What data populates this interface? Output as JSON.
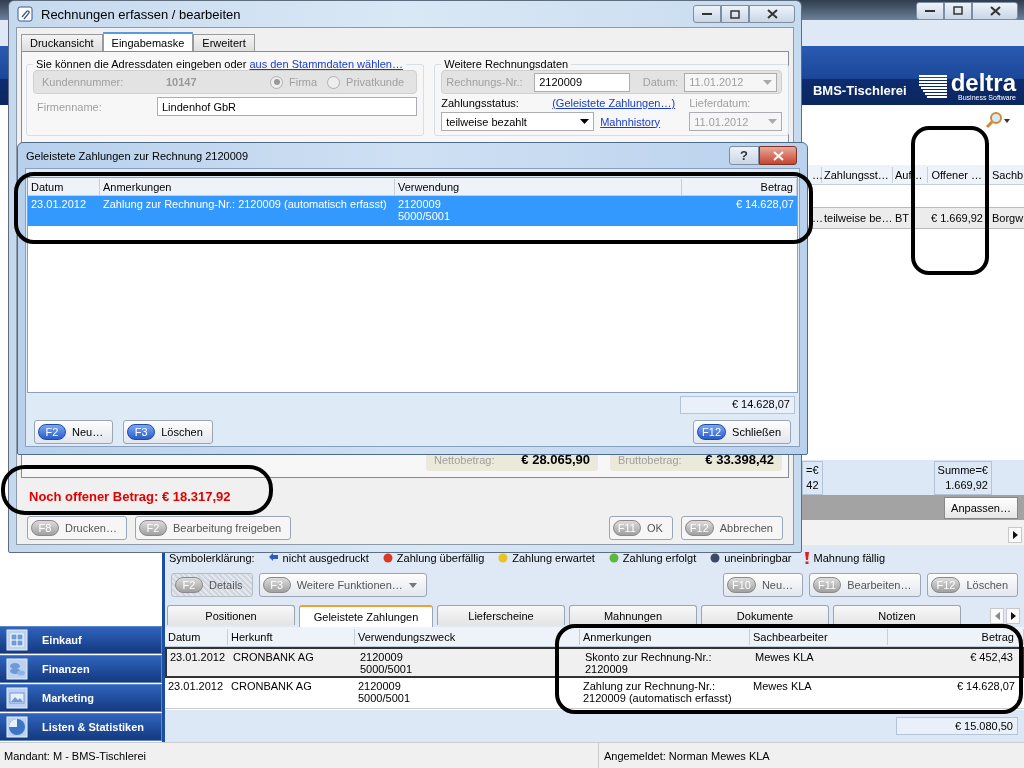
{
  "main_window": {
    "brand": {
      "company": "BMS-Tischlerei",
      "logo_name": "deltra",
      "logo_tagline": "Business Software"
    },
    "invoice_table": {
      "columns": [
        "…",
        "Zahlungsst…",
        "Auf…",
        "Offener …",
        "Sachb"
      ],
      "rows": [
        {
          "cells": [
            "…",
            "teilweise be…",
            "BT",
            "€ 1.669,92",
            "Borgw"
          ],
          "selected": true
        }
      ]
    },
    "totals": [
      {
        "label": "=€",
        "value": "42"
      },
      {
        "label": "Summe=€",
        "value": "1.669,92"
      }
    ],
    "customize_button": "Anpassen…",
    "legend": {
      "title": "Symbolerklärung:",
      "items": [
        {
          "label": "nicht ausgedruckt",
          "kind": "arrow",
          "color": "#2a5cc8"
        },
        {
          "label": "Zahlung überfällig",
          "kind": "dot",
          "color": "#d83a2a"
        },
        {
          "label": "Zahlung erwartet",
          "kind": "dot",
          "color": "#e8c420"
        },
        {
          "label": "Zahlung erfolgt",
          "kind": "dot",
          "color": "#5cb83a"
        },
        {
          "label": "uneinbringbar",
          "kind": "dot",
          "color": "#3a4a66"
        },
        {
          "label": "Mahnung fällig",
          "kind": "exclamation",
          "color": "#e02020"
        }
      ]
    },
    "toolbar_left": [
      {
        "key": "F2",
        "label": "Details",
        "kind": "toggle",
        "disabled": true
      },
      {
        "key": "F3",
        "label": "Weitere Funktionen…",
        "kind": "menu",
        "disabled": true
      }
    ],
    "toolbar_right": [
      {
        "key": "F10",
        "label": "Neu…",
        "disabled": true
      },
      {
        "key": "F11",
        "label": "Bearbeiten…",
        "disabled": true
      },
      {
        "key": "F12",
        "label": "Löschen",
        "disabled": true
      }
    ],
    "detail_tabs": [
      {
        "label": "Positionen",
        "selected": false
      },
      {
        "label": "Geleistete Zahlungen",
        "selected": true
      },
      {
        "label": "Lieferscheine",
        "selected": false
      },
      {
        "label": "Mahnungen",
        "selected": false
      },
      {
        "label": "Dokumente",
        "selected": false
      },
      {
        "label": "Notizen",
        "selected": false
      }
    ],
    "payments_table": {
      "columns": [
        "Datum",
        "Herkunft",
        "Verwendungszweck",
        "Anmerkungen",
        "Sachbearbeiter",
        "Betrag"
      ],
      "rows": [
        {
          "cells": [
            "23.01.2012",
            "CRONBANK AG",
            "2120009\n5000/5001",
            "Skonto zur Rechnung-Nr.:\n2120009",
            "Mewes  KLA",
            "€ 452,43"
          ],
          "selected": true
        },
        {
          "cells": [
            "23.01.2012",
            "CRONBANK AG",
            "2120009\n5000/5001",
            "Zahlung zur Rechnung-Nr.:\n2120009 (automatisch erfasst)",
            "Mewes  KLA",
            "€ 14.628,07"
          ],
          "selected": false
        }
      ],
      "total": "€ 15.080,50"
    },
    "sidebar": {
      "items": [
        {
          "label": "Einkauf"
        },
        {
          "label": "Finanzen"
        },
        {
          "label": "Marketing"
        },
        {
          "label": "Listen & Statistiken"
        }
      ]
    },
    "status_bar": {
      "left": "Mandant: M - BMS-Tischlerei",
      "right": "Angemeldet: Norman Mewes  KLA"
    }
  },
  "invoice_dialog": {
    "title": "Rechnungen erfassen / bearbeiten",
    "tabs": [
      {
        "label": "Druckansicht",
        "selected": false
      },
      {
        "label": "Eingabemaske",
        "selected": true
      },
      {
        "label": "Erweitert",
        "selected": false
      }
    ],
    "address_group": {
      "intro": "Sie können die Adressdaten eingeben oder",
      "link": "aus den Stammdaten wählen…",
      "customer_number_label": "Kundennummer:",
      "customer_number": "10147",
      "customer_types": [
        {
          "label": "Firma",
          "selected": true
        },
        {
          "label": "Privatkunde",
          "selected": false
        }
      ],
      "company_label": "Firmenname:",
      "company": "Lindenhof GbR"
    },
    "invoice_group": {
      "title": "Weitere Rechnungsdaten",
      "number_label": "Rechnungs-Nr.:",
      "number": "2120009",
      "date_label": "Datum:",
      "date": "11.01.2012",
      "status_label": "Zahlungsstatus:",
      "payments_link": "(Geleistete Zahlungen…)",
      "delivery_label": "Lieferdatum:",
      "status": "teilweise bezahlt",
      "dunning_link": "Mahnhistory",
      "delivery_date": "11.01.2012"
    },
    "totals": [
      {
        "label": "Nettobetrag:",
        "value": "€ 28.065,90"
      },
      {
        "label": "Bruttobetrag:",
        "value": "€ 33.398,42"
      }
    ],
    "open_amount": "Noch offener Betrag: € 18.317,92",
    "buttons_left": [
      {
        "key": "F8",
        "label": "Drucken…",
        "disabled": true
      },
      {
        "key": "F2",
        "label": "Bearbeitung freigeben",
        "disabled": true
      }
    ],
    "buttons_right": [
      {
        "key": "F11",
        "label": "OK",
        "disabled": true
      },
      {
        "key": "F12",
        "label": "Abbrechen",
        "disabled": true
      }
    ]
  },
  "payments_dialog": {
    "title": "Geleistete Zahlungen zur Rechnung 2120009",
    "help": "?",
    "columns": [
      "Datum",
      "Anmerkungen",
      "Verwendung",
      "Betrag"
    ],
    "rows": [
      {
        "cells": [
          "23.01.2012",
          "Zahlung zur Rechnung-Nr.: 2120009 (automatisch erfasst)",
          "2120009\n5000/5001",
          "€ 14.628,07"
        ],
        "selected": true
      }
    ],
    "total": "€ 14.628,07",
    "buttons_left": [
      {
        "key": "F2",
        "label": "Neu…",
        "disabled": false
      },
      {
        "key": "F3",
        "label": "Löschen",
        "disabled": false
      }
    ],
    "buttons_right": [
      {
        "key": "F12",
        "label": "Schließen",
        "disabled": false
      }
    ]
  }
}
